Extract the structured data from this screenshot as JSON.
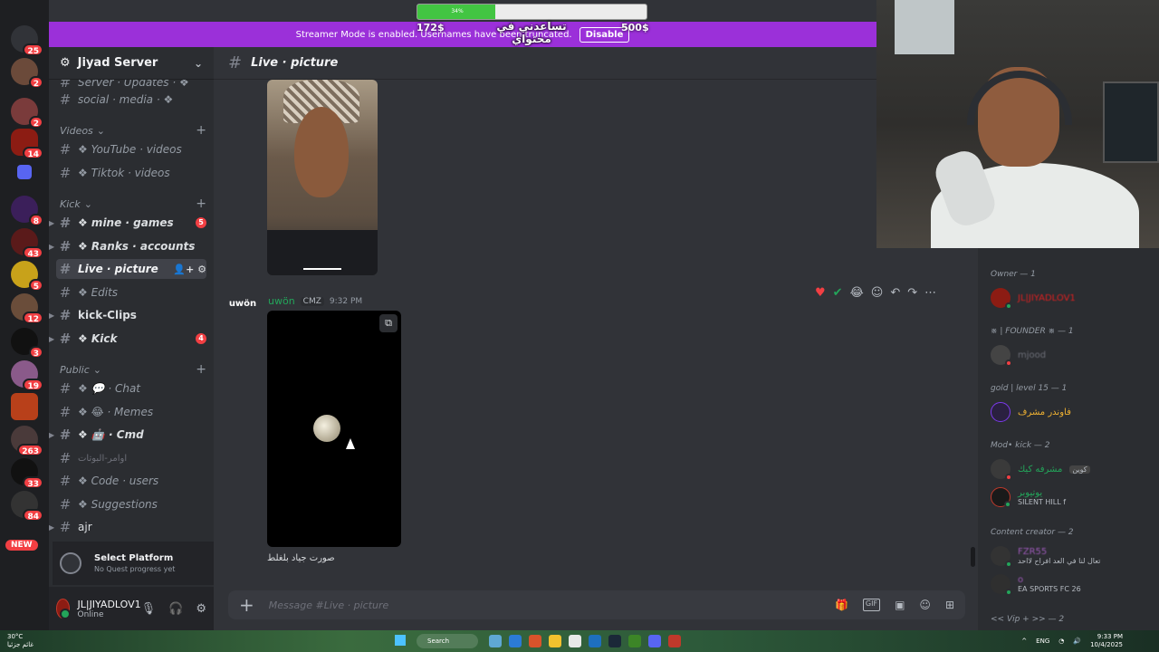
{
  "overlay": {
    "progress_pct": "34%",
    "progress_value": 0.34,
    "goal_current": "172$",
    "goal_target": "500$",
    "goal_title": "تساعدني في محتواي"
  },
  "banner": {
    "text": "Streamer Mode is enabled. Usernames have been truncated.",
    "disable_label": "Disable"
  },
  "server": {
    "name": "Jiyad Server",
    "rail_badges": [
      "25",
      "2",
      "2",
      "14",
      "8",
      "43",
      "5",
      "12",
      "3",
      "19",
      "263",
      "33",
      "84"
    ],
    "new_label": "NEW"
  },
  "channels": {
    "partial_top": "Server · Updates · ❖",
    "social": "social · media · ❖",
    "cat_videos": "Videos",
    "youtube": "❖ YouTube · videos",
    "tiktok": "❖ Tiktok · videos",
    "cat_kick": "Kick",
    "mine_games": "❖ mine · games",
    "mine_games_badge": "5",
    "ranks": "❖ Ranks · accounts",
    "live_picture": "Live · picture",
    "edits": "❖ Edits",
    "kick_clips": "kick-Clips",
    "kick": "❖ Kick",
    "kick_badge": "4",
    "cat_public": "Public",
    "chat": "❖ 💬 · Chat",
    "memes": "❖ 😂 · Memes",
    "cmd": "❖ 🤖 · Cmd",
    "bots_cmd": "اوامر-البوتات",
    "code_users": "❖ Code · users",
    "suggestions": "❖ Suggestions",
    "ajr": "ajr"
  },
  "quest": {
    "title": "Select Platform",
    "subtitle": "No Quest progress yet"
  },
  "user": {
    "name": "JL|JIYADLOV1",
    "status": "Online"
  },
  "chat": {
    "channel_title": "Live · picture",
    "author": "uwön",
    "author_avatar_text": "uwön",
    "tag": "CMZ",
    "time": "9:32 PM",
    "caption": "صورت جياد بلغلط",
    "composer_placeholder": "Message #Live · picture",
    "gif_label": "GIF"
  },
  "members": {
    "owner_header": "Owner — 1",
    "owner_name": "JL|JIYADLOV1",
    "founder_header": "※ | FOUNDER ※ — 1",
    "founder_name": "mjood",
    "gold_header": "gold | level 15 — 1",
    "gold_name": "فاوندر مشرف",
    "mod_header": "Mod• kick — 2",
    "mod1_name": "مشرفه كيك",
    "mod1_tag": "كوين",
    "mod2_name": "يوتيوبر",
    "mod2_activity": "SILENT HILL f",
    "content_header": "Content creator — 2",
    "cc1_name": "FZR55",
    "cc1_activity": "تعال لنا في العد افراح لااحد",
    "cc2_name": "ο",
    "cc2_activity": "EA SPORTS FC 26",
    "vip_header": "<< Vip + >> — 2"
  },
  "taskbar": {
    "temp": "30°C",
    "weather": "غائم جزئيا",
    "search": "Search",
    "lang": "ENG",
    "time": "9:33 PM",
    "date": "10/4/2025"
  }
}
